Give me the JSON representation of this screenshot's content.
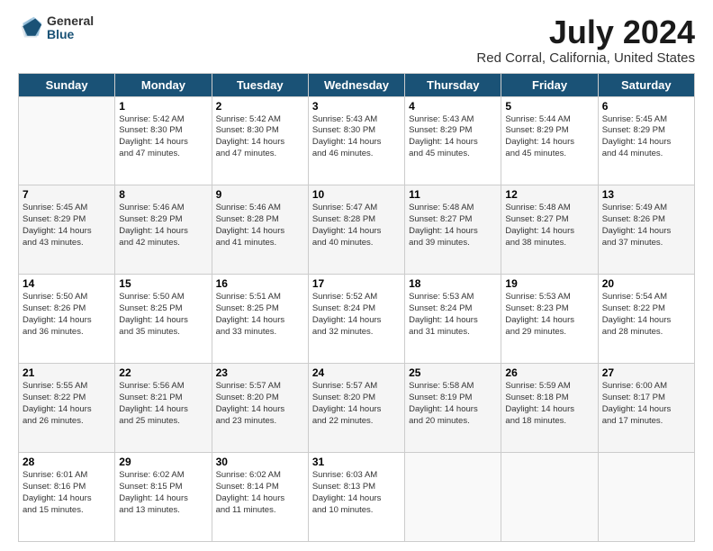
{
  "logo": {
    "general": "General",
    "blue": "Blue"
  },
  "header": {
    "title": "July 2024",
    "subtitle": "Red Corral, California, United States"
  },
  "weekdays": [
    "Sunday",
    "Monday",
    "Tuesday",
    "Wednesday",
    "Thursday",
    "Friday",
    "Saturday"
  ],
  "weeks": [
    [
      null,
      {
        "day": 1,
        "sunrise": "5:42 AM",
        "sunset": "8:30 PM",
        "daylight": "14 hours and 47 minutes."
      },
      {
        "day": 2,
        "sunrise": "5:42 AM",
        "sunset": "8:30 PM",
        "daylight": "14 hours and 47 minutes."
      },
      {
        "day": 3,
        "sunrise": "5:43 AM",
        "sunset": "8:30 PM",
        "daylight": "14 hours and 46 minutes."
      },
      {
        "day": 4,
        "sunrise": "5:43 AM",
        "sunset": "8:29 PM",
        "daylight": "14 hours and 45 minutes."
      },
      {
        "day": 5,
        "sunrise": "5:44 AM",
        "sunset": "8:29 PM",
        "daylight": "14 hours and 45 minutes."
      },
      {
        "day": 6,
        "sunrise": "5:45 AM",
        "sunset": "8:29 PM",
        "daylight": "14 hours and 44 minutes."
      }
    ],
    [
      {
        "day": 7,
        "sunrise": "5:45 AM",
        "sunset": "8:29 PM",
        "daylight": "14 hours and 43 minutes."
      },
      {
        "day": 8,
        "sunrise": "5:46 AM",
        "sunset": "8:29 PM",
        "daylight": "14 hours and 42 minutes."
      },
      {
        "day": 9,
        "sunrise": "5:46 AM",
        "sunset": "8:28 PM",
        "daylight": "14 hours and 41 minutes."
      },
      {
        "day": 10,
        "sunrise": "5:47 AM",
        "sunset": "8:28 PM",
        "daylight": "14 hours and 40 minutes."
      },
      {
        "day": 11,
        "sunrise": "5:48 AM",
        "sunset": "8:27 PM",
        "daylight": "14 hours and 39 minutes."
      },
      {
        "day": 12,
        "sunrise": "5:48 AM",
        "sunset": "8:27 PM",
        "daylight": "14 hours and 38 minutes."
      },
      {
        "day": 13,
        "sunrise": "5:49 AM",
        "sunset": "8:26 PM",
        "daylight": "14 hours and 37 minutes."
      }
    ],
    [
      {
        "day": 14,
        "sunrise": "5:50 AM",
        "sunset": "8:26 PM",
        "daylight": "14 hours and 36 minutes."
      },
      {
        "day": 15,
        "sunrise": "5:50 AM",
        "sunset": "8:25 PM",
        "daylight": "14 hours and 35 minutes."
      },
      {
        "day": 16,
        "sunrise": "5:51 AM",
        "sunset": "8:25 PM",
        "daylight": "14 hours and 33 minutes."
      },
      {
        "day": 17,
        "sunrise": "5:52 AM",
        "sunset": "8:24 PM",
        "daylight": "14 hours and 32 minutes."
      },
      {
        "day": 18,
        "sunrise": "5:53 AM",
        "sunset": "8:24 PM",
        "daylight": "14 hours and 31 minutes."
      },
      {
        "day": 19,
        "sunrise": "5:53 AM",
        "sunset": "8:23 PM",
        "daylight": "14 hours and 29 minutes."
      },
      {
        "day": 20,
        "sunrise": "5:54 AM",
        "sunset": "8:22 PM",
        "daylight": "14 hours and 28 minutes."
      }
    ],
    [
      {
        "day": 21,
        "sunrise": "5:55 AM",
        "sunset": "8:22 PM",
        "daylight": "14 hours and 26 minutes."
      },
      {
        "day": 22,
        "sunrise": "5:56 AM",
        "sunset": "8:21 PM",
        "daylight": "14 hours and 25 minutes."
      },
      {
        "day": 23,
        "sunrise": "5:57 AM",
        "sunset": "8:20 PM",
        "daylight": "14 hours and 23 minutes."
      },
      {
        "day": 24,
        "sunrise": "5:57 AM",
        "sunset": "8:20 PM",
        "daylight": "14 hours and 22 minutes."
      },
      {
        "day": 25,
        "sunrise": "5:58 AM",
        "sunset": "8:19 PM",
        "daylight": "14 hours and 20 minutes."
      },
      {
        "day": 26,
        "sunrise": "5:59 AM",
        "sunset": "8:18 PM",
        "daylight": "14 hours and 18 minutes."
      },
      {
        "day": 27,
        "sunrise": "6:00 AM",
        "sunset": "8:17 PM",
        "daylight": "14 hours and 17 minutes."
      }
    ],
    [
      {
        "day": 28,
        "sunrise": "6:01 AM",
        "sunset": "8:16 PM",
        "daylight": "14 hours and 15 minutes."
      },
      {
        "day": 29,
        "sunrise": "6:02 AM",
        "sunset": "8:15 PM",
        "daylight": "14 hours and 13 minutes."
      },
      {
        "day": 30,
        "sunrise": "6:02 AM",
        "sunset": "8:14 PM",
        "daylight": "14 hours and 11 minutes."
      },
      {
        "day": 31,
        "sunrise": "6:03 AM",
        "sunset": "8:13 PM",
        "daylight": "14 hours and 10 minutes."
      },
      null,
      null,
      null
    ]
  ]
}
